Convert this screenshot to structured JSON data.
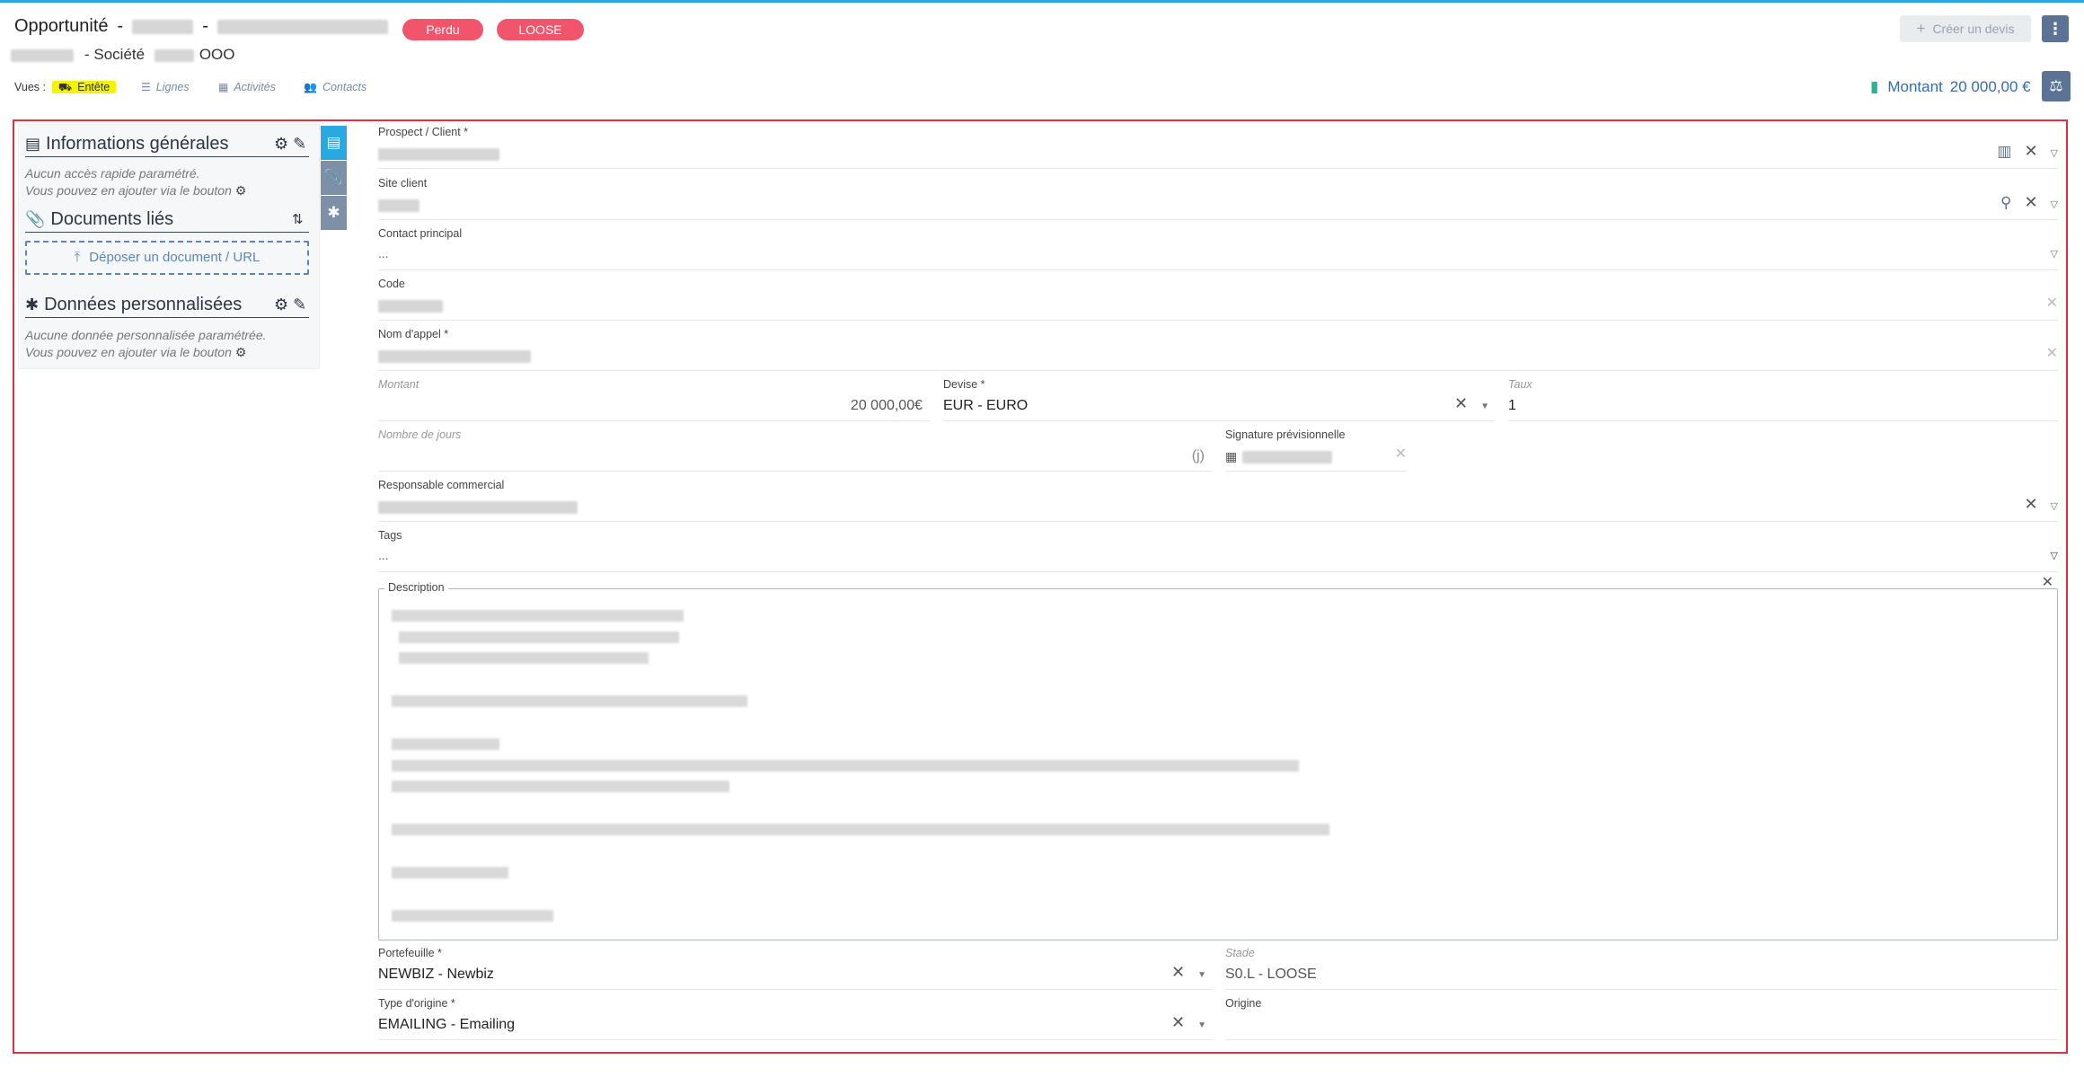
{
  "header": {
    "title": "Opportunité",
    "subtitle_prefix": "- Société",
    "subtitle_suffix": "OOO",
    "badges": [
      "Perdu",
      "LOOSE"
    ],
    "create_quote_label": "Créer un devis",
    "more_label": "⋮",
    "amount_label": "Montant",
    "amount_value": "20 000,00 €"
  },
  "views": {
    "label": "Vues :",
    "items": [
      "Entête",
      "Lignes",
      "Activités",
      "Contacts"
    ],
    "active": "Entête"
  },
  "left_panel": {
    "general_info": {
      "title": "Informations générales",
      "note_1": "Aucun accès rapide paramétré.",
      "note_2": "Vous pouvez en ajouter via le bouton"
    },
    "linked_docs": {
      "title": "Documents liés",
      "drop_label": "Déposer un document / URL"
    },
    "custom_data": {
      "title": "Données personnalisées",
      "note_1": "Aucune donnée personnalisée paramétrée.",
      "note_2": "Vous pouvez en ajouter via le bouton"
    }
  },
  "form": {
    "prospect_label": "Prospect / Client *",
    "site_label": "Site client",
    "contact_label": "Contact principal",
    "contact_value": "...",
    "code_label": "Code",
    "name_label": "Nom d'appel *",
    "amount_label": "Montant",
    "amount_value": "20 000,00€",
    "currency_label": "Devise *",
    "currency_value": "EUR - EURO",
    "rate_label": "Taux",
    "rate_value": "1",
    "days_label": "Nombre de jours",
    "days_unit": "(j)",
    "signature_label": "Signature prévisionnelle",
    "sales_rep_label": "Responsable commercial",
    "tags_label": "Tags",
    "tags_value": "...",
    "description_label": "Description",
    "portfolio_label": "Portefeuille *",
    "portfolio_value": "NEWBIZ - Newbiz",
    "stage_label": "Stade",
    "stage_value": "S0.L - LOOSE",
    "origin_type_label": "Type d'origine *",
    "origin_type_value": "EMAILING - Emailing",
    "origin_label": "Origine"
  },
  "colors": {
    "accent": "#29a8e0",
    "badge": "#f1556c",
    "frame": "#e03040",
    "amount": "#2f6db5",
    "highlight": "#f4f400"
  }
}
